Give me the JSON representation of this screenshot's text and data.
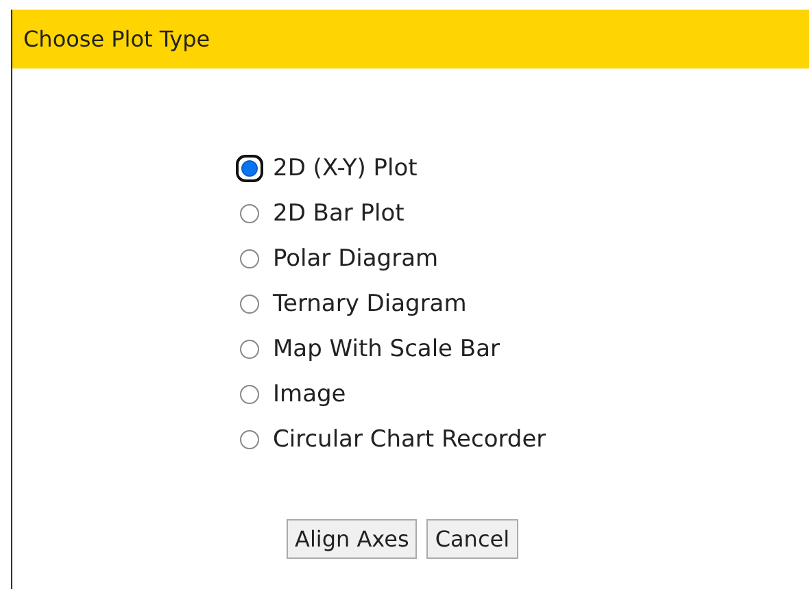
{
  "dialog": {
    "title": "Choose Plot Type"
  },
  "options": [
    {
      "label": "2D (X-Y) Plot",
      "selected": true
    },
    {
      "label": "2D Bar Plot",
      "selected": false
    },
    {
      "label": "Polar Diagram",
      "selected": false
    },
    {
      "label": "Ternary Diagram",
      "selected": false
    },
    {
      "label": "Map With Scale Bar",
      "selected": false
    },
    {
      "label": "Image",
      "selected": false
    },
    {
      "label": "Circular Chart Recorder",
      "selected": false
    }
  ],
  "buttons": [
    "Align Axes",
    "Cancel"
  ]
}
